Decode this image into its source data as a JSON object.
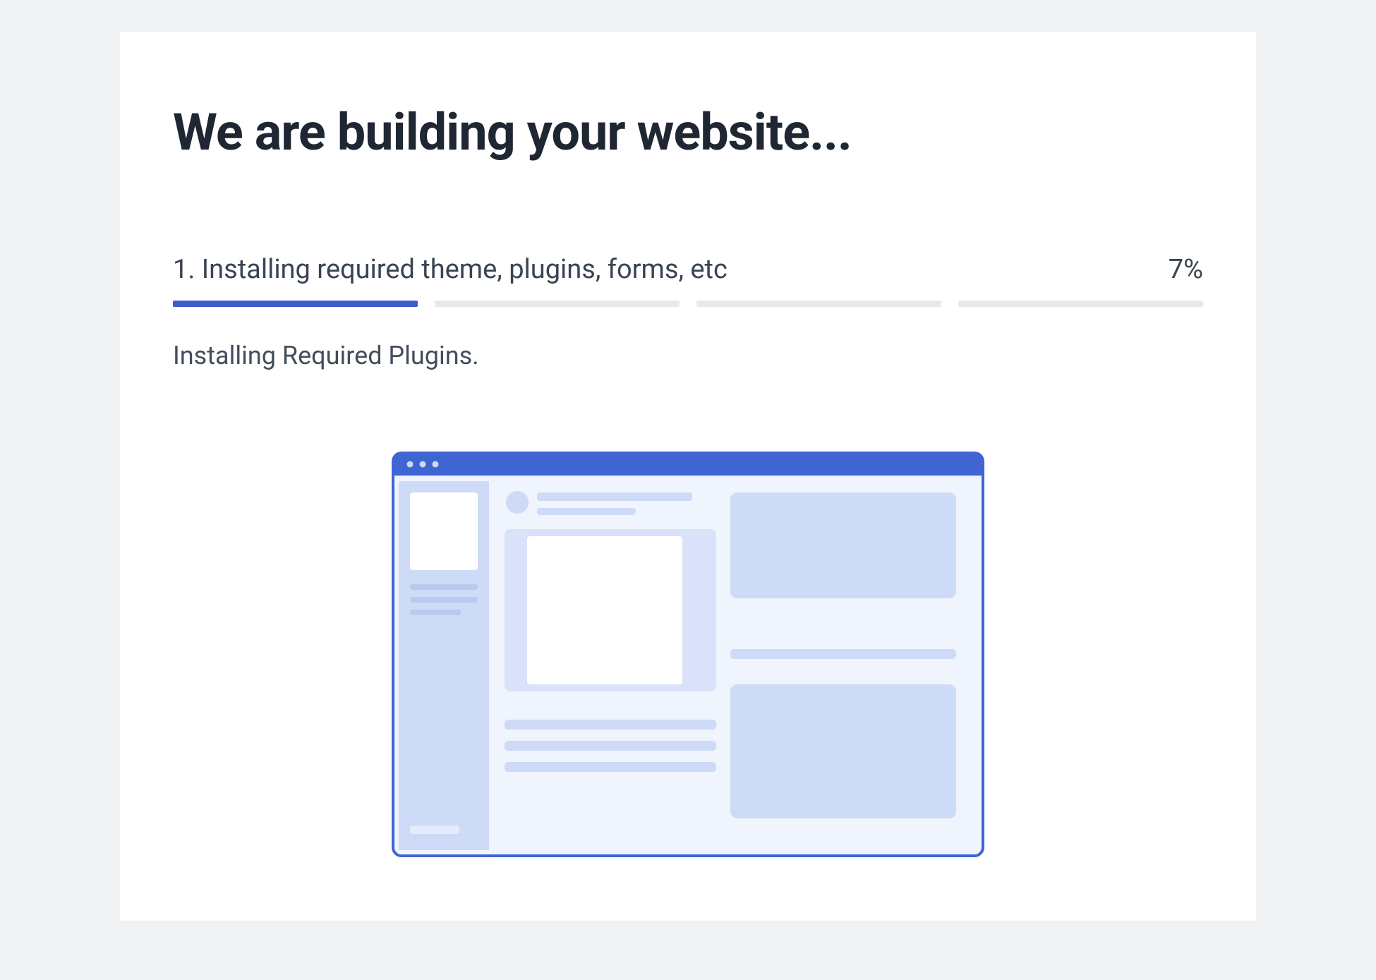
{
  "heading": "We are building your website...",
  "progress": {
    "step_number": "1",
    "step_label": "1. Installing required theme, plugins, forms, etc",
    "percent_text": "7%",
    "percent_value": 7,
    "total_segments": 4,
    "active_segment_index": 0,
    "active_segment_fill_percent": 100
  },
  "status_text": "Installing Required Plugins.",
  "colors": {
    "accent": "#3b5ecb",
    "light_fill": "#d9e2f8",
    "bg_track": "#e7e9ec",
    "heading_text": "#1f2733",
    "body_text": "#444d5d"
  }
}
